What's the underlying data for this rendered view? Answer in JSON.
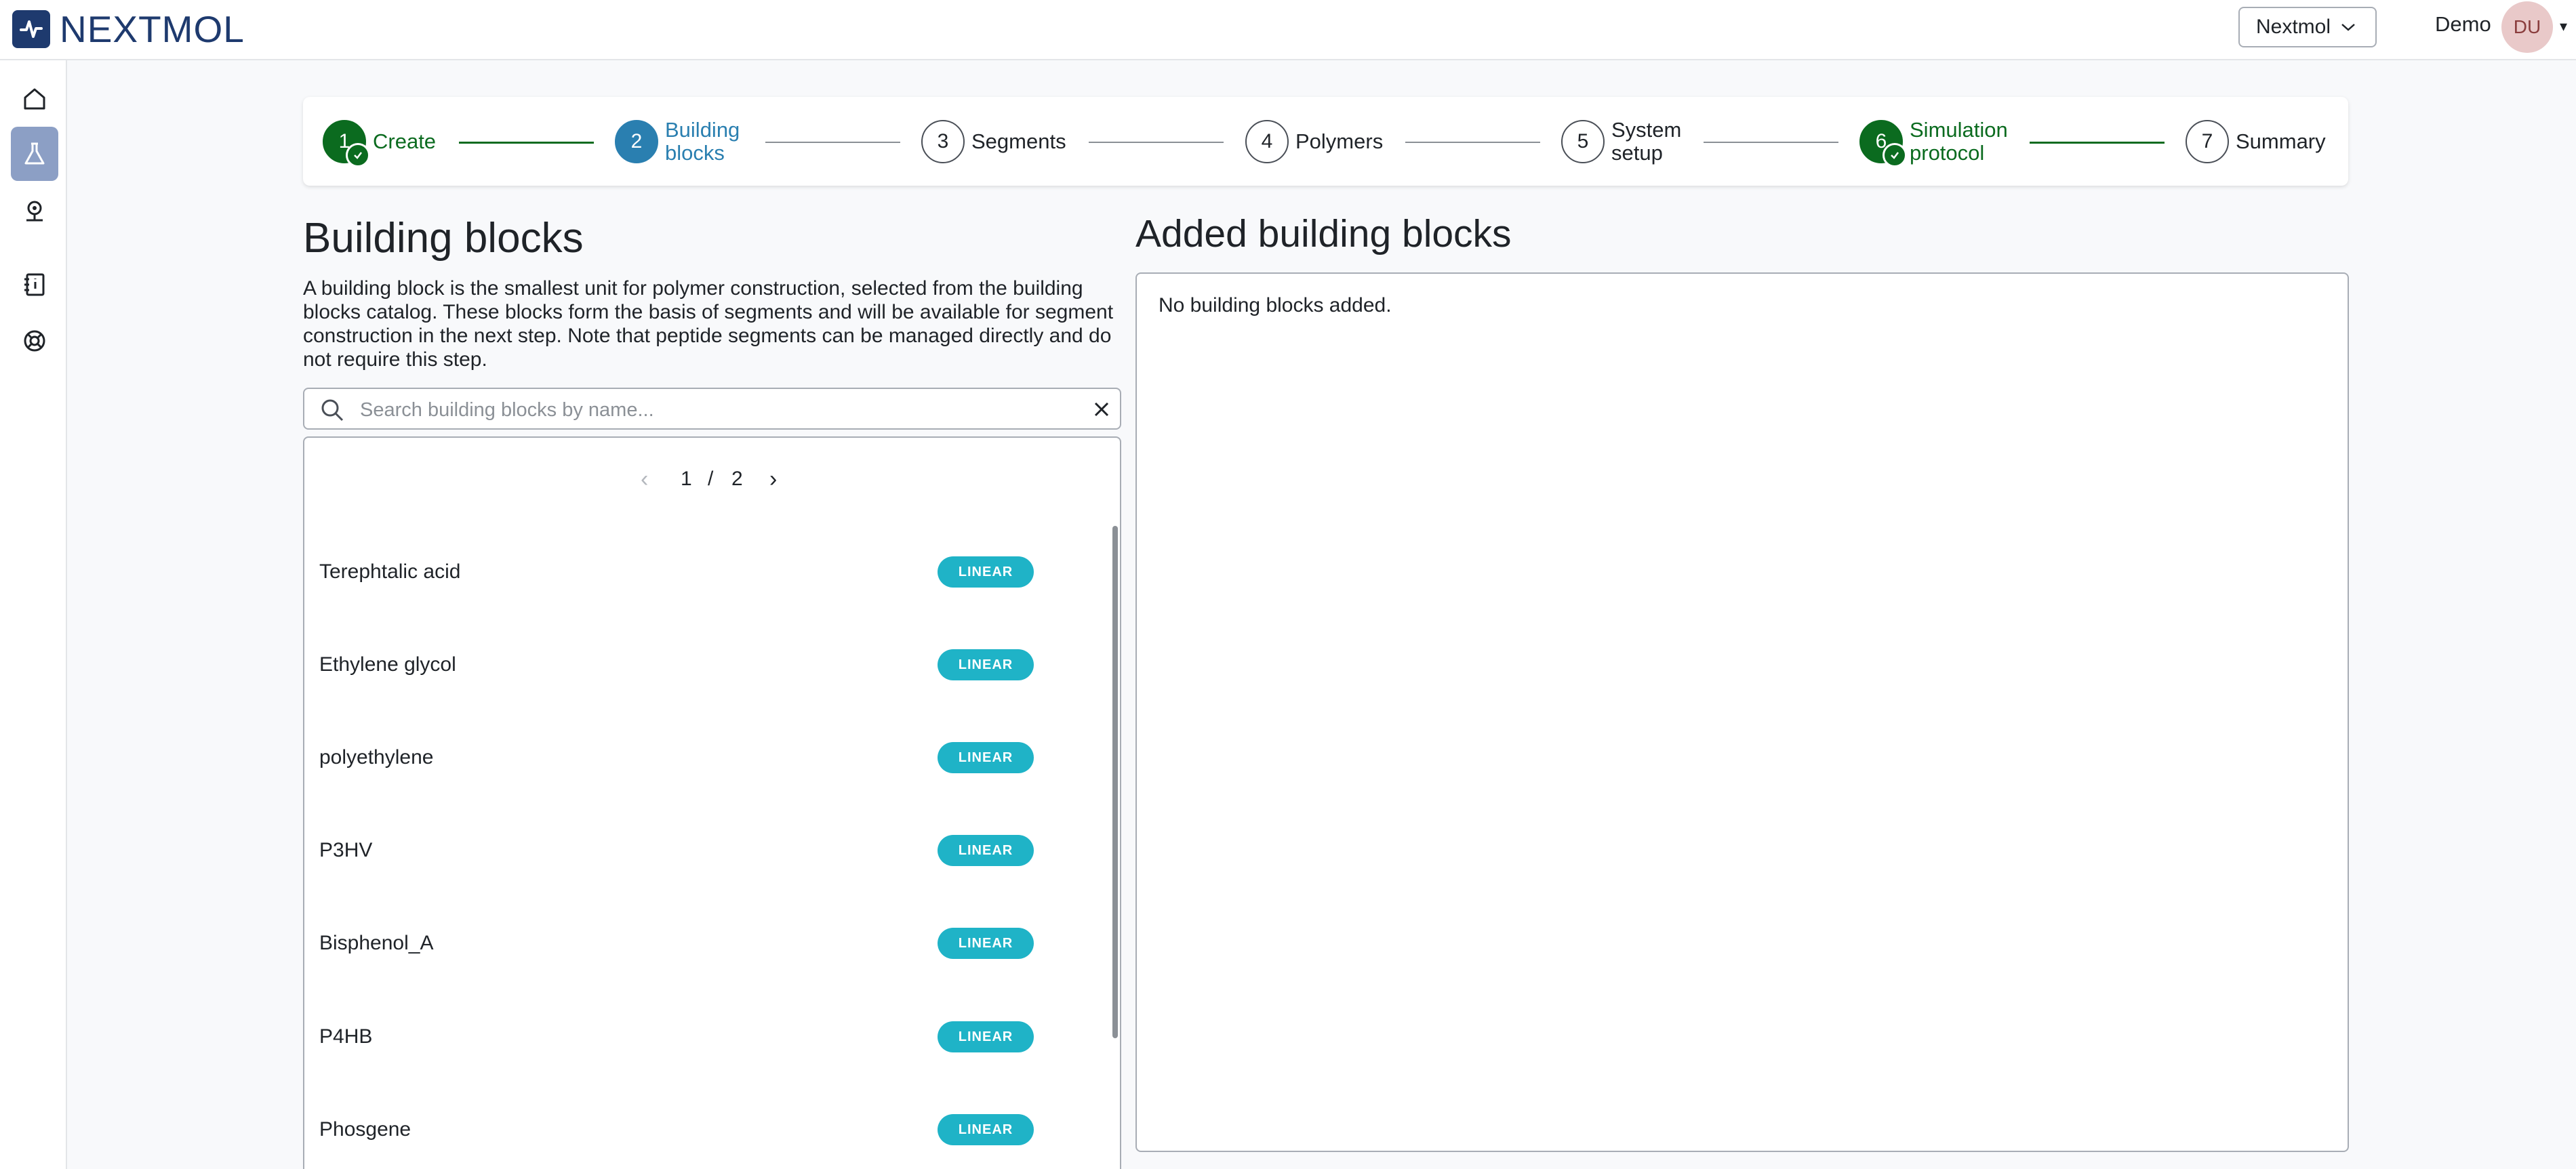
{
  "app": {
    "brand": "NEXTMOL"
  },
  "header": {
    "org_select": "Nextmol",
    "user_name": "Demo",
    "avatar_initials": "DU"
  },
  "sidebar": {
    "items": [
      {
        "icon": "home-icon",
        "active": false
      },
      {
        "icon": "flask-icon",
        "active": true
      },
      {
        "icon": "microscope-icon",
        "active": false
      },
      {
        "icon": "notebook-icon",
        "active": false
      },
      {
        "icon": "lifebuoy-icon",
        "active": false
      }
    ]
  },
  "stepper": {
    "steps": [
      {
        "number": "1",
        "label": "Create",
        "state": "done"
      },
      {
        "number": "2",
        "label_line1": "Building",
        "label_line2": "blocks",
        "state": "current"
      },
      {
        "number": "3",
        "label": "Segments",
        "state": "todo"
      },
      {
        "number": "4",
        "label": "Polymers",
        "state": "todo"
      },
      {
        "number": "5",
        "label_line1": "System",
        "label_line2": "setup",
        "state": "todo"
      },
      {
        "number": "6",
        "label_line1": "Simulation",
        "label_line2": "protocol",
        "state": "done"
      },
      {
        "number": "7",
        "label": "Summary",
        "state": "todo"
      }
    ]
  },
  "building_blocks": {
    "title": "Building blocks",
    "description": "A building block is the smallest unit for polymer construction, selected from the building blocks catalog. These blocks form the basis of segments and will be available for segment construction in the next step. Note that peptide segments can be managed directly and do not require this step.",
    "search_placeholder": "Search building blocks by name...",
    "pagination": {
      "current": "1",
      "separator": "/",
      "total": "2"
    },
    "items": [
      {
        "name": "Terephtalic acid",
        "type": "LINEAR"
      },
      {
        "name": "Ethylene glycol",
        "type": "LINEAR"
      },
      {
        "name": "polyethylene",
        "type": "LINEAR"
      },
      {
        "name": "P3HV",
        "type": "LINEAR"
      },
      {
        "name": "Bisphenol_A",
        "type": "LINEAR"
      },
      {
        "name": "P4HB",
        "type": "LINEAR"
      },
      {
        "name": "Phosgene",
        "type": "LINEAR"
      }
    ]
  },
  "added": {
    "title": "Added building blocks",
    "empty_message": "No building blocks added."
  },
  "colors": {
    "brand": "#1e3a6e",
    "done_green": "#0b6b1f",
    "current_blue": "#2a7fb0",
    "badge_cyan": "#1fb3c7",
    "sidebar_active": "#8c9fc5"
  }
}
